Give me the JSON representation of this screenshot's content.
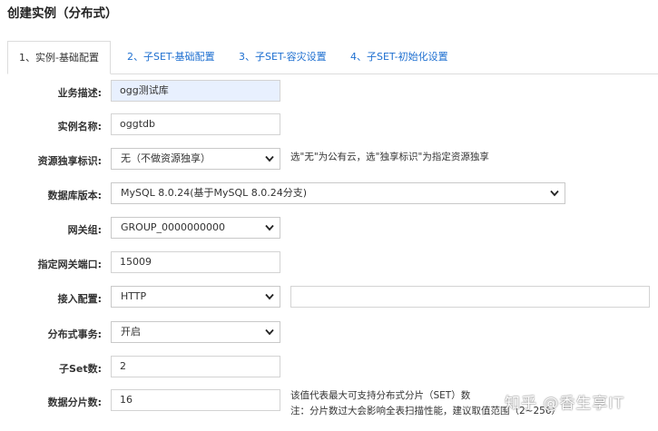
{
  "page": {
    "title": "创建实例（分布式）"
  },
  "tabs": [
    {
      "label": "1、实例-基础配置"
    },
    {
      "label": "2、子SET-基础配置"
    },
    {
      "label": "3、子SET-容灾设置"
    },
    {
      "label": "4、子SET-初始化设置"
    }
  ],
  "form": {
    "business_desc": {
      "label": "业务描述:",
      "value": "ogg测试库"
    },
    "instance_name": {
      "label": "实例名称:",
      "value": "oggtdb"
    },
    "resource_exclusive": {
      "label": "资源独享标识:",
      "selected": "无（不做资源独享）",
      "hint": "选\"无\"为公有云，选\"独享标识\"为指定资源独享"
    },
    "db_version": {
      "label": "数据库版本:",
      "selected": "MySQL 8.0.24(基于MySQL 8.0.24分支)"
    },
    "gateway_group": {
      "label": "网关组:",
      "selected": "GROUP_0000000000"
    },
    "gateway_port": {
      "label": "指定网关端口:",
      "value": "15009"
    },
    "access_config": {
      "label": "接入配置:",
      "selected": "HTTP",
      "extra_value": ""
    },
    "distributed_tx": {
      "label": "分布式事务:",
      "selected": "开启"
    },
    "subset_count": {
      "label": "子Set数:",
      "value": "2"
    },
    "shard_count": {
      "label": "数据分片数:",
      "value": "16",
      "hint_line1": "该值代表最大可支持分布式分片（SET）数",
      "hint_line2": "注：分片数过大会影响全表扫描性能，建议取值范围（2~256）"
    }
  },
  "watermark": "知乎 @香生享IT",
  "icons": {
    "select_arrow": "chevron-down-icon"
  }
}
